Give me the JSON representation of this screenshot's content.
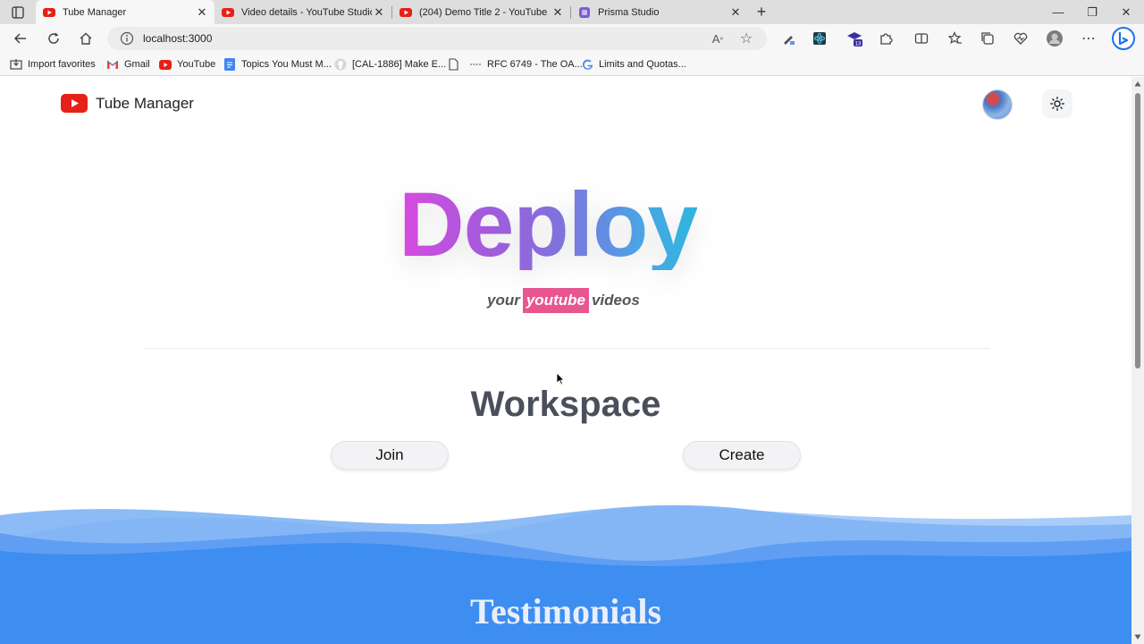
{
  "browser": {
    "tabs": [
      {
        "title": "Tube Manager",
        "favicon": "youtube-icon",
        "active": true
      },
      {
        "title": "Video details - YouTube Studio",
        "favicon": "youtube-icon",
        "active": false
      },
      {
        "title": "(204) Demo Title 2 - YouTube",
        "favicon": "youtube-icon",
        "active": false
      },
      {
        "title": "Prisma Studio",
        "favicon": "prisma-icon",
        "active": false
      }
    ],
    "close_glyph": "✕",
    "new_tab_glyph": "+",
    "window_controls": {
      "minimize": "—",
      "restore": "❐",
      "close": "✕"
    },
    "url": "localhost:3000",
    "bookmarks": [
      {
        "label": "Import favorites",
        "icon": "import-icon"
      },
      {
        "label": "Gmail",
        "icon": "gmail-icon"
      },
      {
        "label": "YouTube",
        "icon": "youtube-icon"
      },
      {
        "label": "Topics You Must M...",
        "icon": "docs-icon"
      },
      {
        "label": "[CAL-1886] Make E...",
        "icon": "github-icon"
      },
      {
        "label": "",
        "icon": "page-icon"
      },
      {
        "label": "RFC 6749 - The OA...",
        "icon": "dotted-icon"
      },
      {
        "label": "Limits and Quotas...",
        "icon": "google-icon"
      }
    ]
  },
  "app": {
    "brand": "Tube Manager",
    "hero": {
      "title": "Deploy",
      "subtitle_before": "your",
      "subtitle_highlight": "youtube",
      "subtitle_after": "videos"
    },
    "workspace": {
      "title": "Workspace",
      "join_label": "Join",
      "create_label": "Create"
    },
    "testimonials_title": "Testimonials"
  },
  "colors": {
    "youtube_red": "#e62117",
    "highlight_pink": "#e8568f",
    "wave_blue": "#3d8ef0",
    "wave_light": "#7fb4f5"
  }
}
